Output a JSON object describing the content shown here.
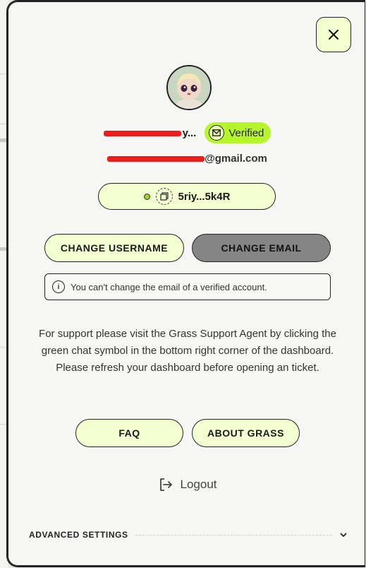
{
  "profile": {
    "username_suffix": "y...",
    "email_suffix": "@gmail.com",
    "verified_label": "Verified",
    "wallet": "5riy...5k4R"
  },
  "actions": {
    "change_username": "CHANGE USERNAME",
    "change_email": "CHANGE EMAIL"
  },
  "notice": {
    "text": "You can't change the email of a verified account."
  },
  "support": {
    "text": "For support please visit the Grass Support Agent by clicking the green chat symbol in the bottom right corner of the dashboard. Please refresh your dashboard before opening an ticket."
  },
  "links": {
    "faq": "FAQ",
    "about": "ABOUT GRASS"
  },
  "logout_label": "Logout",
  "advanced_label": "ADVANCED SETTINGS",
  "icons": [
    "close-icon",
    "avatar",
    "verified-mail-icon",
    "copy-icon",
    "info-icon",
    "logout-icon",
    "chevron-down-icon"
  ],
  "colors": {
    "accent_green": "#b6f52a",
    "light_green": "#f4ffd1",
    "disabled_gray": "#858585"
  }
}
